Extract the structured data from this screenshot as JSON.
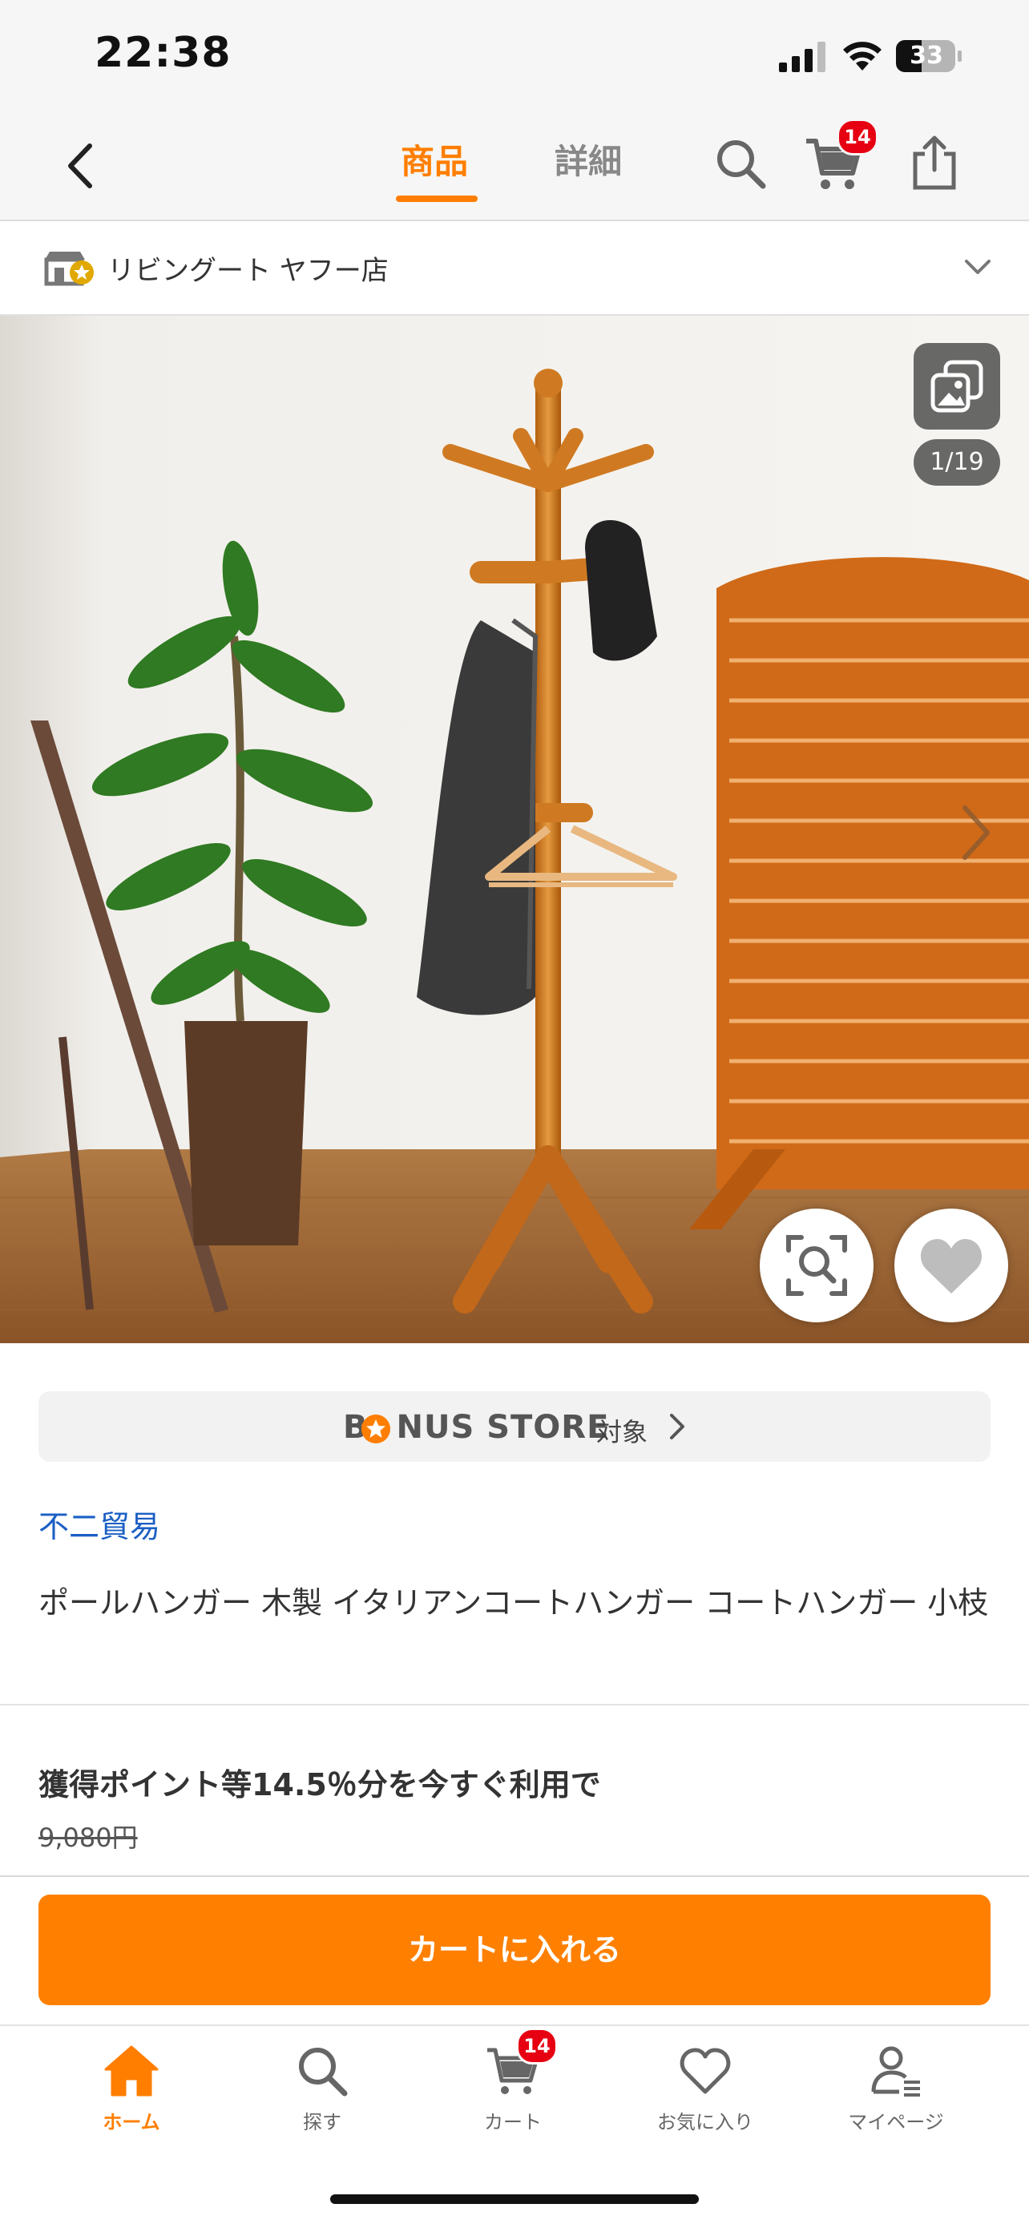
{
  "status_bar": {
    "time": "22:38",
    "battery": "33"
  },
  "nav": {
    "tabs": [
      {
        "label": "商品",
        "active": true
      },
      {
        "label": "詳細",
        "active": false
      }
    ],
    "cart_badge": "14",
    "icons": [
      "back-icon",
      "search-icon",
      "cart-icon",
      "share-icon"
    ]
  },
  "store": {
    "name": "リビングート ヤフー店"
  },
  "gallery": {
    "counter": "1/19"
  },
  "bonus": {
    "logo": "BONUS STORE",
    "label": "対象"
  },
  "product": {
    "brand": "不二貿易",
    "title": "ポールハンガー 木製 イタリアンコートハンガー コートハンガー 小枝"
  },
  "pricing": {
    "points_text": "獲得ポイント等14.5％分を今すぐ利用で",
    "original_price": "9,080円"
  },
  "actions": {
    "add_to_cart": "カートに入れる"
  },
  "tab_bar": {
    "items": [
      {
        "label": "ホーム",
        "icon": "home-icon",
        "active": true
      },
      {
        "label": "探す",
        "icon": "search-icon",
        "active": false
      },
      {
        "label": "カート",
        "icon": "cart-icon",
        "active": false
      },
      {
        "label": "お気に入り",
        "icon": "heart-icon",
        "active": false
      },
      {
        "label": "マイページ",
        "icon": "person-icon",
        "active": false
      }
    ],
    "cart_badge": "14"
  },
  "colors": {
    "accent": "#ff7e00",
    "badge": "#e60012",
    "link": "#1b5fc4",
    "button": "#ff8000"
  }
}
